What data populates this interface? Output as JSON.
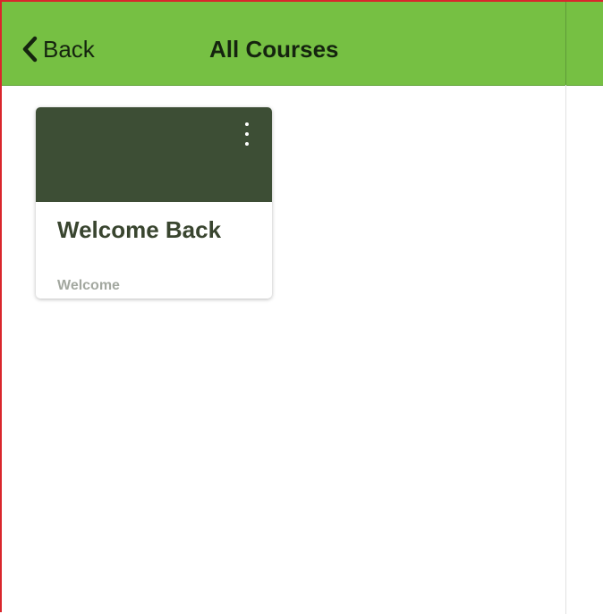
{
  "header": {
    "back_label": "Back",
    "title": "All Courses"
  },
  "courses": [
    {
      "title": "Welcome Back",
      "subtitle": "Welcome",
      "banner_color": "#3d4e35"
    }
  ],
  "colors": {
    "header_bg": "#76c043",
    "card_title": "#39452f",
    "card_subtitle": "#a3a8a0"
  },
  "icons": {
    "back": "chevron-left-icon",
    "course_menu": "more-vertical-icon"
  }
}
